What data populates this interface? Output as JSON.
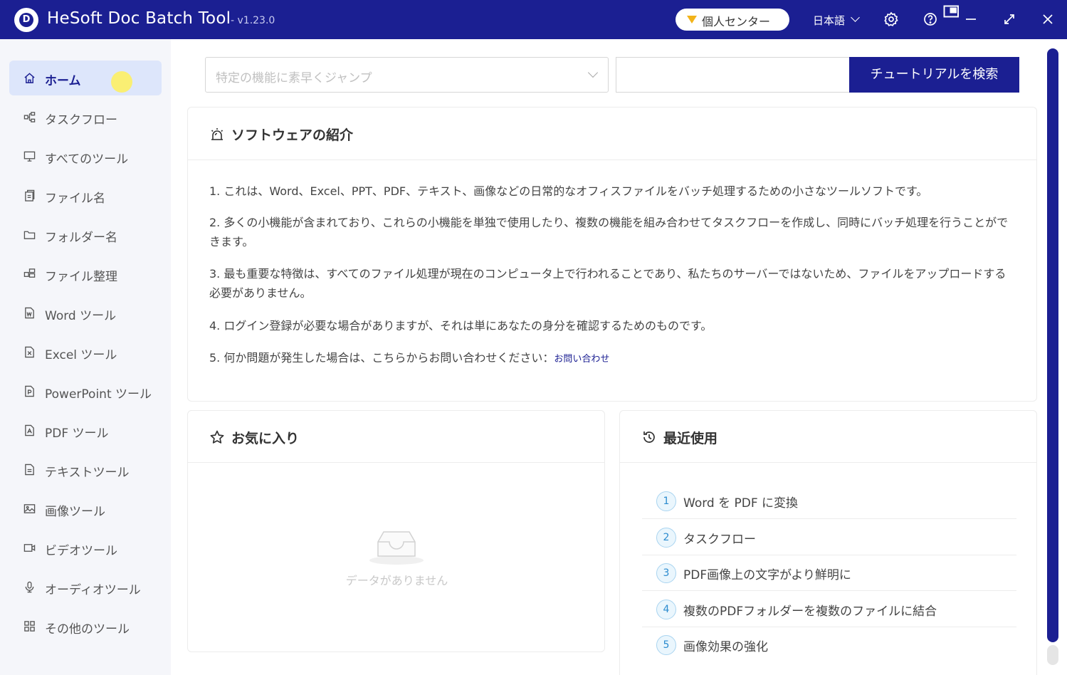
{
  "titlebar": {
    "app_name": "HeSoft Doc Batch Tool",
    "version": "- v1.23.0",
    "personal_center": "個人センター",
    "language": "日本語"
  },
  "sidebar": {
    "items": [
      {
        "label": "ホーム",
        "icon": "home-icon",
        "active": true
      },
      {
        "label": "タスクフロー",
        "icon": "flow-icon"
      },
      {
        "label": "すべてのツール",
        "icon": "monitor-icon"
      },
      {
        "label": "ファイル名",
        "icon": "file-copy-icon"
      },
      {
        "label": "フォルダー名",
        "icon": "folder-icon"
      },
      {
        "label": "ファイル整理",
        "icon": "organize-icon"
      },
      {
        "label": "Word ツール",
        "icon": "word-file-icon"
      },
      {
        "label": "Excel ツール",
        "icon": "excel-file-icon"
      },
      {
        "label": "PowerPoint ツール",
        "icon": "ppt-file-icon"
      },
      {
        "label": "PDF ツール",
        "icon": "pdf-file-icon"
      },
      {
        "label": "テキストツール",
        "icon": "text-file-icon"
      },
      {
        "label": "画像ツール",
        "icon": "image-icon"
      },
      {
        "label": "ビデオツール",
        "icon": "video-icon"
      },
      {
        "label": "オーディオツール",
        "icon": "microphone-icon"
      },
      {
        "label": "その他のツール",
        "icon": "grid-icon"
      }
    ]
  },
  "search": {
    "placeholder": "特定の機能に素早くジャンプ",
    "tutorial_button": "チュートリアルを検索"
  },
  "intro": {
    "title": "ソフトウェアの紹介",
    "paragraphs": [
      "1. これは、Word、Excel、PPT、PDF、テキスト、画像などの日常的なオフィスファイルをバッチ処理するための小さなツールソフトです。",
      "2. 多くの小機能が含まれており、これらの小機能を単独で使用したり、複数の機能を組み合わせてタスクフローを作成し、同時にバッチ処理を行うことができます。",
      "3. 最も重要な特徴は、すべてのファイル処理が現在のコンピュータ上で行われることであり、私たちのサーバーではないため、ファイルをアップロードする必要がありません。",
      "4. ログイン登録が必要な場合がありますが、それは単にあなたの身分を確認するためのものです。",
      "5. 何か問題が発生した場合は、こちらからお問い合わせください："
    ],
    "contact_link": "お問い合わせ"
  },
  "favorites": {
    "title": "お気に入り",
    "empty_text": "データがありません"
  },
  "recent": {
    "title": "最近使用",
    "items": [
      {
        "num": "1",
        "label": "Word を PDF に変換"
      },
      {
        "num": "2",
        "label": "タスクフロー"
      },
      {
        "num": "3",
        "label": "PDF画像上の文字がより鮮明に"
      },
      {
        "num": "4",
        "label": "複数のPDFフォルダーを複数のファイルに結合"
      },
      {
        "num": "5",
        "label": "画像効果の強化"
      }
    ]
  },
  "colors": {
    "brand": "#1b1f92",
    "sidebar_bg": "#f5f6fa",
    "active_bg": "#dde6fb"
  }
}
